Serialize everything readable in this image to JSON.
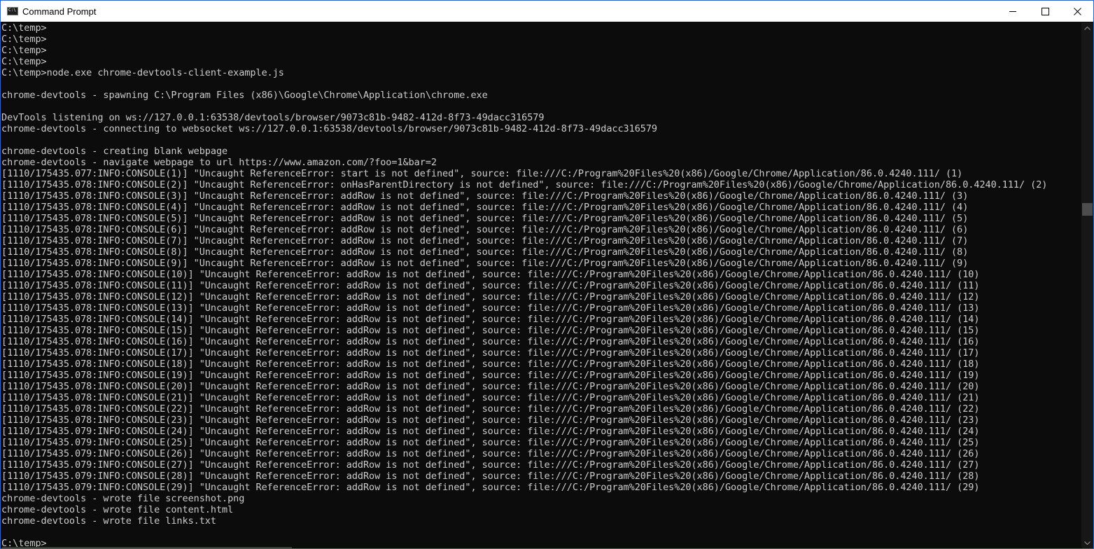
{
  "window": {
    "title": "Command Prompt",
    "icon": "cmd-icon",
    "controls": {
      "minimize": "minimize-icon",
      "maximize": "maximize-icon",
      "close": "close-icon"
    }
  },
  "colors": {
    "background": "#0c0c0c",
    "text": "#cccccc",
    "titlebar": "#ffffff",
    "border": "#2b64c4"
  },
  "console": {
    "lines": [
      "C:\\temp>",
      "C:\\temp>",
      "C:\\temp>",
      "C:\\temp>",
      "C:\\temp>node.exe chrome-devtools-client-example.js",
      "",
      "chrome-devtools - spawning C:\\Program Files (x86)\\Google\\Chrome\\Application\\chrome.exe",
      "",
      "DevTools listening on ws://127.0.0.1:63538/devtools/browser/9073c81b-9482-412d-8f73-49dacc316579",
      "chrome-devtools - connecting to websocket ws://127.0.0.1:63538/devtools/browser/9073c81b-9482-412d-8f73-49dacc316579",
      "",
      "chrome-devtools - creating blank webpage",
      "chrome-devtools - navigate webpage to url https://www.amazon.com/?foo=1&bar=2",
      "[1110/175435.077:INFO:CONSOLE(1)] \"Uncaught ReferenceError: start is not defined\", source: file:///C:/Program%20Files%20(x86)/Google/Chrome/Application/86.0.4240.111/ (1)",
      "[1110/175435.078:INFO:CONSOLE(2)] \"Uncaught ReferenceError: onHasParentDirectory is not defined\", source: file:///C:/Program%20Files%20(x86)/Google/Chrome/Application/86.0.4240.111/ (2)",
      "[1110/175435.078:INFO:CONSOLE(3)] \"Uncaught ReferenceError: addRow is not defined\", source: file:///C:/Program%20Files%20(x86)/Google/Chrome/Application/86.0.4240.111/ (3)",
      "[1110/175435.078:INFO:CONSOLE(4)] \"Uncaught ReferenceError: addRow is not defined\", source: file:///C:/Program%20Files%20(x86)/Google/Chrome/Application/86.0.4240.111/ (4)",
      "[1110/175435.078:INFO:CONSOLE(5)] \"Uncaught ReferenceError: addRow is not defined\", source: file:///C:/Program%20Files%20(x86)/Google/Chrome/Application/86.0.4240.111/ (5)",
      "[1110/175435.078:INFO:CONSOLE(6)] \"Uncaught ReferenceError: addRow is not defined\", source: file:///C:/Program%20Files%20(x86)/Google/Chrome/Application/86.0.4240.111/ (6)",
      "[1110/175435.078:INFO:CONSOLE(7)] \"Uncaught ReferenceError: addRow is not defined\", source: file:///C:/Program%20Files%20(x86)/Google/Chrome/Application/86.0.4240.111/ (7)",
      "[1110/175435.078:INFO:CONSOLE(8)] \"Uncaught ReferenceError: addRow is not defined\", source: file:///C:/Program%20Files%20(x86)/Google/Chrome/Application/86.0.4240.111/ (8)",
      "[1110/175435.078:INFO:CONSOLE(9)] \"Uncaught ReferenceError: addRow is not defined\", source: file:///C:/Program%20Files%20(x86)/Google/Chrome/Application/86.0.4240.111/ (9)",
      "[1110/175435.078:INFO:CONSOLE(10)] \"Uncaught ReferenceError: addRow is not defined\", source: file:///C:/Program%20Files%20(x86)/Google/Chrome/Application/86.0.4240.111/ (10)",
      "[1110/175435.078:INFO:CONSOLE(11)] \"Uncaught ReferenceError: addRow is not defined\", source: file:///C:/Program%20Files%20(x86)/Google/Chrome/Application/86.0.4240.111/ (11)",
      "[1110/175435.078:INFO:CONSOLE(12)] \"Uncaught ReferenceError: addRow is not defined\", source: file:///C:/Program%20Files%20(x86)/Google/Chrome/Application/86.0.4240.111/ (12)",
      "[1110/175435.078:INFO:CONSOLE(13)] \"Uncaught ReferenceError: addRow is not defined\", source: file:///C:/Program%20Files%20(x86)/Google/Chrome/Application/86.0.4240.111/ (13)",
      "[1110/175435.078:INFO:CONSOLE(14)] \"Uncaught ReferenceError: addRow is not defined\", source: file:///C:/Program%20Files%20(x86)/Google/Chrome/Application/86.0.4240.111/ (14)",
      "[1110/175435.078:INFO:CONSOLE(15)] \"Uncaught ReferenceError: addRow is not defined\", source: file:///C:/Program%20Files%20(x86)/Google/Chrome/Application/86.0.4240.111/ (15)",
      "[1110/175435.078:INFO:CONSOLE(16)] \"Uncaught ReferenceError: addRow is not defined\", source: file:///C:/Program%20Files%20(x86)/Google/Chrome/Application/86.0.4240.111/ (16)",
      "[1110/175435.078:INFO:CONSOLE(17)] \"Uncaught ReferenceError: addRow is not defined\", source: file:///C:/Program%20Files%20(x86)/Google/Chrome/Application/86.0.4240.111/ (17)",
      "[1110/175435.078:INFO:CONSOLE(18)] \"Uncaught ReferenceError: addRow is not defined\", source: file:///C:/Program%20Files%20(x86)/Google/Chrome/Application/86.0.4240.111/ (18)",
      "[1110/175435.078:INFO:CONSOLE(19)] \"Uncaught ReferenceError: addRow is not defined\", source: file:///C:/Program%20Files%20(x86)/Google/Chrome/Application/86.0.4240.111/ (19)",
      "[1110/175435.078:INFO:CONSOLE(20)] \"Uncaught ReferenceError: addRow is not defined\", source: file:///C:/Program%20Files%20(x86)/Google/Chrome/Application/86.0.4240.111/ (20)",
      "[1110/175435.078:INFO:CONSOLE(21)] \"Uncaught ReferenceError: addRow is not defined\", source: file:///C:/Program%20Files%20(x86)/Google/Chrome/Application/86.0.4240.111/ (21)",
      "[1110/175435.078:INFO:CONSOLE(22)] \"Uncaught ReferenceError: addRow is not defined\", source: file:///C:/Program%20Files%20(x86)/Google/Chrome/Application/86.0.4240.111/ (22)",
      "[1110/175435.078:INFO:CONSOLE(23)] \"Uncaught ReferenceError: addRow is not defined\", source: file:///C:/Program%20Files%20(x86)/Google/Chrome/Application/86.0.4240.111/ (23)",
      "[1110/175435.079:INFO:CONSOLE(24)] \"Uncaught ReferenceError: addRow is not defined\", source: file:///C:/Program%20Files%20(x86)/Google/Chrome/Application/86.0.4240.111/ (24)",
      "[1110/175435.079:INFO:CONSOLE(25)] \"Uncaught ReferenceError: addRow is not defined\", source: file:///C:/Program%20Files%20(x86)/Google/Chrome/Application/86.0.4240.111/ (25)",
      "[1110/175435.079:INFO:CONSOLE(26)] \"Uncaught ReferenceError: addRow is not defined\", source: file:///C:/Program%20Files%20(x86)/Google/Chrome/Application/86.0.4240.111/ (26)",
      "[1110/175435.079:INFO:CONSOLE(27)] \"Uncaught ReferenceError: addRow is not defined\", source: file:///C:/Program%20Files%20(x86)/Google/Chrome/Application/86.0.4240.111/ (27)",
      "[1110/175435.079:INFO:CONSOLE(28)] \"Uncaught ReferenceError: addRow is not defined\", source: file:///C:/Program%20Files%20(x86)/Google/Chrome/Application/86.0.4240.111/ (28)",
      "[1110/175435.079:INFO:CONSOLE(29)] \"Uncaught ReferenceError: addRow is not defined\", source: file:///C:/Program%20Files%20(x86)/Google/Chrome/Application/86.0.4240.111/ (29)",
      "chrome-devtools - wrote file screenshot.png",
      "chrome-devtools - wrote file content.html",
      "chrome-devtools - wrote file links.txt",
      "",
      "C:\\temp>"
    ]
  },
  "scrollbar": {
    "up_icon": "scroll-up-arrow-icon",
    "down_icon": "scroll-down-arrow-icon"
  }
}
